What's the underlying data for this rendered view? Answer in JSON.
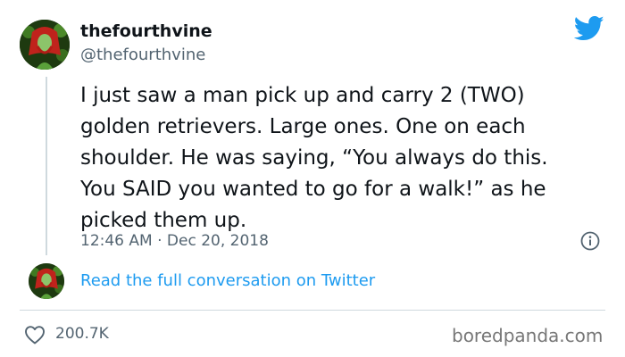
{
  "tweet": {
    "display_name": "thefourthvine",
    "handle": "@thefourthvine",
    "text_lines": [
      "I just saw a man pick up and carry 2 (TWO)",
      "golden retrievers. Large ones. One on each",
      "shoulder. He was saying, “You always do this.",
      "You SAID you wanted to go for a walk!” as he",
      "picked them up."
    ],
    "timestamp": "12:46 AM · Dec 20, 2018",
    "read_link_label": "Read the full conversation on Twitter",
    "like_count": "200.7K"
  },
  "icons": {
    "brand": "twitter-bird-icon",
    "info": "info-icon",
    "like": "heart-icon"
  },
  "colors": {
    "link": "#1d9bf0",
    "twitter_brand": "#1d9bf0",
    "secondary_text": "#536471"
  },
  "watermark": "boredpanda.com"
}
